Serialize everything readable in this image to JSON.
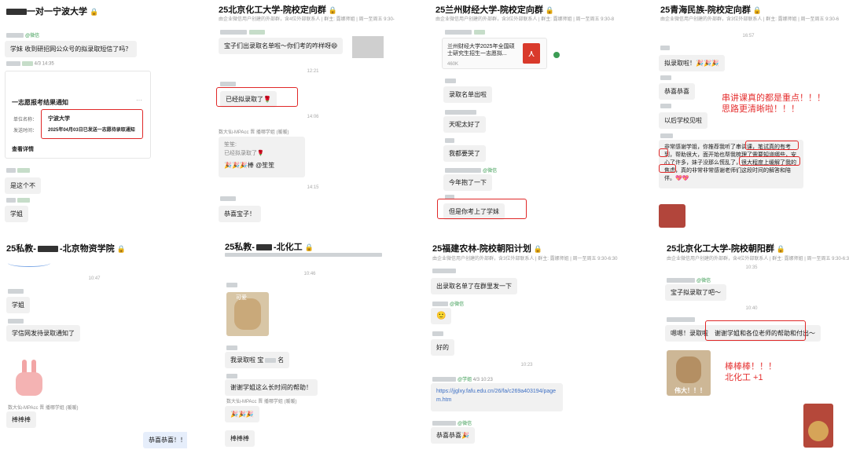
{
  "p1": {
    "title": "一对一宁波大学",
    "s1": "学妹 收到研招网公众号的拟录取短信了吗？",
    "time1": "4/3 14:35",
    "tag": "@微信",
    "card_title": "一志愿报考结果通知",
    "card_more": "···",
    "unit_label": "单位名称：",
    "unit_value": "宁波大学",
    "date_label": "发送时间：",
    "date_value": "2025年04月03日已发送一志愿待录取通知",
    "card_link": "查看详情",
    "b2": "是这个不",
    "b3": "学姐"
  },
  "p2": {
    "title": "25北京化工大学-院校定向群",
    "subtitle": "由企业微信用户创建的外部群，含4位外部联系人 | 群主: 露娜师姐 | 周一至周五 9:30-",
    "b1": "宝子们出录取名单啦～你们考的咋样呀😄",
    "t1": "12:21",
    "b2": "已经拟录取了🌹",
    "t2": "14:06",
    "sender3": "数大仙-MPAcc 晋 播哪学姐 (暖暖)",
    "quote1": "笙笙:",
    "quote2": "已经拟录取了🌹",
    "b3": "🎉🎉🎉棒 @笙笙",
    "t3": "14:15",
    "b4": "恭喜宝子！"
  },
  "p3": {
    "title": "25兰州财经大学-院校定向群",
    "subtitle": "由企业微信用户创建的外部群，含3位外部联系人 | 群主: 露娜师姐 | 周一至周五 9:30-8",
    "file_name": "兰州财经大学2025年全国硕士研究生招生一志愿拟...",
    "file_size": "460K",
    "b1": "录取名单出啦",
    "b2": "天呢太好了",
    "b3": "我都要哭了",
    "b4": "今年抱了一下",
    "b5": "但是你考上了学妹",
    "tag": "@微信"
  },
  "p4": {
    "title": "25青海民族-院校定向群",
    "subtitle": "由企业微信用户创建的外部群，含3位外部联系人 | 群主: 露娜师姐 | 周一至周五 9:30-6",
    "t1": "16:57",
    "b1": "拟录取啦！🎉🎉🎉",
    "b2": "恭喜恭喜",
    "b3": "以后学校见啦",
    "red1": "串讲课真的都是重点！！！",
    "red2": "思路更清晰啦！！！",
    "b4": "非常感谢学姐，你推荐我听了串讲课，笔试真的有考到，帮助很大，面开始也帮我梳理了需要知道哪些，安心了许多，妹子没那么慌乱了，很大程度上缓解了我的焦虑，真的非常非常感谢老师们这段时间的解答和陪伴。💖💖"
  },
  "p5": {
    "title": "25私教-",
    "title2": "-北京物资学院",
    "t1": "10:47",
    "b1": "学姐",
    "b2": "学信网发待录取通知了",
    "sender3": "数大仙-MPAcc 晋 播哪学姐 (暖暖)",
    "b3": "棒棒棒",
    "b4": "恭喜恭喜！！"
  },
  "p6": {
    "title": "25私教-",
    "title2": "-北化工",
    "t1": "10:46",
    "sticker": "可爱",
    "b1": "我录取啦 宝",
    "b1b": "名",
    "b2": "谢谢学姐这么长时间的帮助！",
    "sender3": "数大仙-MPAcc 晋 播哪学姐 (暖暖)",
    "b3": "🎉🎉🎉",
    "b4": "棒棒棒"
  },
  "p7": {
    "title": "25福建农林-院校朝阳计划",
    "subtitle": "由企业微信用户创建的外部群，含3位外部联系人 | 群主: 露娜师姐 | 周一至周五 9:30-6:30",
    "b1": "出录取名单了在群里发一下",
    "b2": "好的",
    "t1": "10:23",
    "time2": "4/3 10:23",
    "link": "https://jjglxy.fafu.edu.cn/26/fa/c269a403194/pagem.htm",
    "b3": "恭喜恭喜🎉",
    "tag": "@微信",
    "tag2": "@学姐"
  },
  "p8": {
    "title": "25北京化工大学-院校朝阳群",
    "subtitle": "由企业微信用户创建的外部群，含4位外部联系人 | 群主: 露娜师姐 | 周一至周五 9:30-6:30",
    "t1": "10:35",
    "b1": "宝子拟录取了吧～",
    "t2": "10:40",
    "b2a": "嗯嗯！录取啦",
    "b2b": "谢谢学姐和各位老师的帮助和付出～",
    "red1": "棒棒棒！！！",
    "red2": "北化工 +1",
    "sticker": "伟大！！！",
    "tag": "@微信"
  }
}
